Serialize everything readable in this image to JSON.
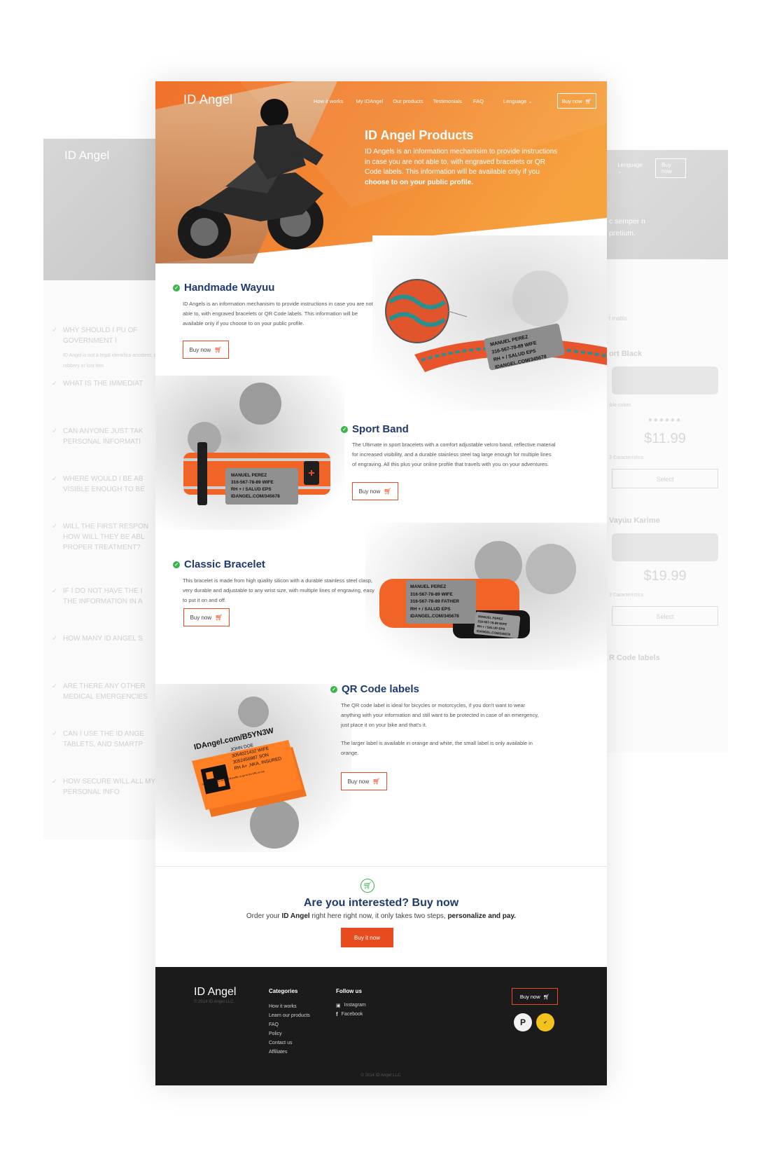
{
  "ghost_left": {
    "logo": "ID Angel",
    "questions": [
      "WHY SHOULD I PU OF GOVERNMENT I",
      "WHAT IS THE IMMEDIAT",
      "CAN ANYONE JUST TAK PERSONAL INFORMATI",
      "WHERE WOULD I BE AB VISIBLE ENOUGH TO BE",
      "WILL THE FIRST RESPON HOW WILL THEY BE ABL PROPER TREATMENT?",
      "IF I DO NOT HAVE THE I THE INFORMATION IN A",
      "HOW MANY ID ANGEL S",
      "ARE THERE ANY OTHER MEDICAL EMERGENCIES",
      "CAN I USE THE ID ANGE TABLETS, AND SMARTP",
      "HOW SECURE WILL ALL MY PERSONAL INFO"
    ],
    "answer": "ID Angel is not a legal identifica accident, a robbery or lost iten"
  },
  "ghost_right": {
    "nav": [
      "Q",
      "Lenguage ⌄",
      "Buy now"
    ],
    "hero_text": "c semper n pretium.",
    "mattis": "t mattis",
    "card1_title": "ort Black",
    "colors_label": "ible colors",
    "card1_price": "$11.99",
    "card1_feat": "3 Característica",
    "select": "Select",
    "card2_title": "Vayúu Karime",
    "card2_price": "$19.99",
    "card2_feat": "3 Característica",
    "card3_title": "R Code labels"
  },
  "nav": {
    "logo": "ID Angel",
    "links": [
      "How it works",
      "My IDAngel",
      "Our products",
      "Testimonials",
      "FAQ"
    ],
    "language": "Lenguage ⌄",
    "buy": "Buy now"
  },
  "hero": {
    "title": "ID Angel Products",
    "desc_plain": "ID Angels is an information mechanisim to provide instructions in case you are not able to, with engraved bracelets or QR Code labels. This information will be available only if you",
    "desc_bold": "choose to on your public profile."
  },
  "products": [
    {
      "title": "Handmade Wayuu",
      "desc": "ID Angels is an information mechanisim to provide instructions in case you are not able to, with engraved bracelets or QR Code labels. This information will be available only if you choose to on your public profile.",
      "buy": "Buy now",
      "tag": [
        "MANUEL PEREZ",
        "316-567-78-89 WIFE",
        "RH + / SALUD EPS",
        "IDANGEL.COM/345678"
      ]
    },
    {
      "title": "Sport Band",
      "desc": "The Ultimate in sport bracelets with a comfort adjustable velcro band, reflective material for increased visibility, and a durable stainless steel tag large enough for multiple lines of engraving. All this plus your online profile that travels with you on your adventures.",
      "buy": "Buy now",
      "tag": [
        "MANUEL PEREZ",
        "316-567-78-89 WIFE",
        "RH + / SALUD EPS",
        "IDANGEL.COM/345678"
      ]
    },
    {
      "title": "Classic Bracelet",
      "desc": "This bracelet is made from high quality silicon with a durable stainless steel clasp, very durable and adjustable to any wrist size, with multiple lines of engraving, easy to put it on and off.",
      "buy": "Buy now",
      "tag": [
        "MANUEL PEREZ",
        "316-567-78-89 WIFE",
        "316-567-78-89 FATHER",
        "RH + / SALUD EPS",
        "IDANGEL.COM/345678"
      ],
      "tag_small": [
        "MANUEL PEREZ",
        "316-567-78-89 WIFE",
        "RH + / SALUD EPS",
        "IDANGEL.COM/345678"
      ]
    },
    {
      "title": "QR Code labels",
      "desc": "The QR code label is ideal for bicycles or motorcycles, if you don't want to wear anything with your information and still want to be protected in case of an emergency, just place it on your bike and that's it.",
      "desc2": "The larger label is available in orange and white, the small label is only available in orange.",
      "buy": "Buy now",
      "label_url": "IDAngel.com/B5YN3W",
      "label_lines": [
        "JOHN DOE",
        "3054021432  WIFE",
        "3052456987 SON",
        "RH A+ ,NKA, INSURED"
      ],
      "label_scan": "Scan the code to view a full profile, or go to the URL on top"
    }
  ],
  "cta": {
    "title": "Are you interested? Buy now",
    "sub_1": "Order your",
    "sub_brand": "ID Angel",
    "sub_2": "right here right now, it only takes two steps,",
    "sub_bold": "personalize and pay.",
    "button": "Buy it now"
  },
  "footer": {
    "logo": "ID Angel",
    "copy_small": "© 2014 ID Angel LLC.",
    "categories_title": "Categories",
    "categories": [
      "How it works",
      "Learn our products",
      "FAQ",
      "Policy",
      "Contact us",
      "Affiliates"
    ],
    "follow_title": "Follow us",
    "social": [
      "Instagram",
      "Facebook"
    ],
    "buy": "Buy now",
    "bottom": "© 2014 ID Angel LLC."
  },
  "colors": {
    "accent": "#e84b1e",
    "title_navy": "#1e3a6e",
    "check_green": "#3bb54a",
    "footer_bg": "#1b1b1b"
  }
}
